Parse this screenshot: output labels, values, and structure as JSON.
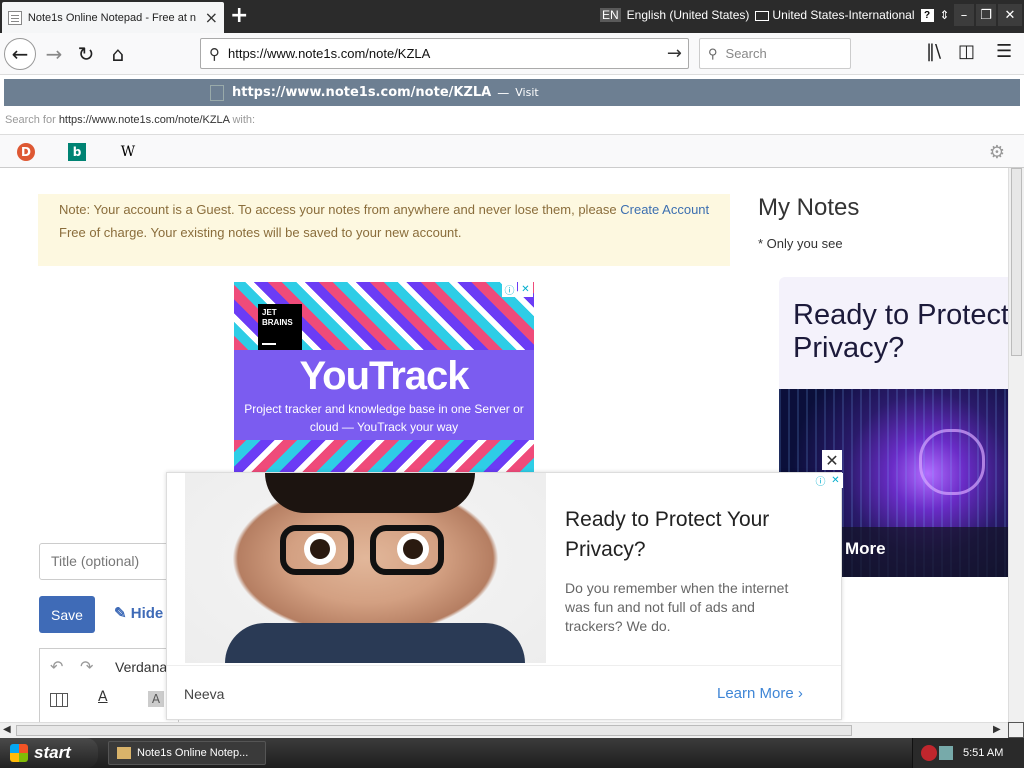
{
  "browser": {
    "tab_title": "Note1s Online Notepad - Free at n",
    "tab_close": "×",
    "new_tab": "+",
    "language_indicator": {
      "lang_code": "EN",
      "language": "English (United States)",
      "keyboard": "United States-International"
    },
    "nav": {
      "back": "←",
      "forward": "→",
      "reload": "↻",
      "home": "⌂"
    },
    "address": "https://www.note1s.com/note/KZLA",
    "search_placeholder": "Search",
    "suggestion": {
      "url": "https://www.note1s.com/note/KZLA",
      "dash": "—",
      "action": "Visit"
    },
    "search_for_prefix": "Search for",
    "search_for_query": "https://www.note1s.com/note/KZLA",
    "search_for_suffix": "with:",
    "engines": [
      "DuckDuckGo",
      "Bing",
      "Wikipedia"
    ]
  },
  "page": {
    "notice": {
      "text_before": "Note: Your account is a Guest. To access your notes from anywhere and never lose them, please ",
      "link": "Create Account",
      "text_after": " Free of charge. Your existing notes will be saved to your new account."
    },
    "my_notes": {
      "title": "My Notes",
      "subtitle": "* Only you see"
    },
    "youtrack_ad": {
      "brand_line1": "JET",
      "brand_line2": "BRAINS",
      "title": "YouTrack",
      "subtitle": "Project tracker and knowledge base in one Server or cloud — YouTrack your way"
    },
    "side_ad": {
      "title": "Ready to Protect Your Privacy?",
      "cta": "More"
    },
    "editor": {
      "title_placeholder": "Title (optional)",
      "save_label": "Save",
      "hide_label": "Hide",
      "font_name": "Verdana",
      "undo": "↶",
      "redo": "↷",
      "text_color": "A",
      "bg_color": "A"
    },
    "overlay_ad": {
      "title": "Ready to Protect Your Privacy?",
      "body": "Do you remember when the internet was fun and not full of ads and trackers? We do.",
      "brand": "Neeva",
      "cta": "Learn More",
      "close": "✕"
    }
  },
  "taskbar": {
    "start": "start",
    "task_item": "Note1s Online Notep...",
    "clock": "5:51 AM"
  },
  "colors": {
    "accent": "#3f6bb7",
    "notice_bg": "#fdf8e0",
    "suggestion_bg": "#6d7f92",
    "youtrack_purple": "#7b5cf0"
  }
}
